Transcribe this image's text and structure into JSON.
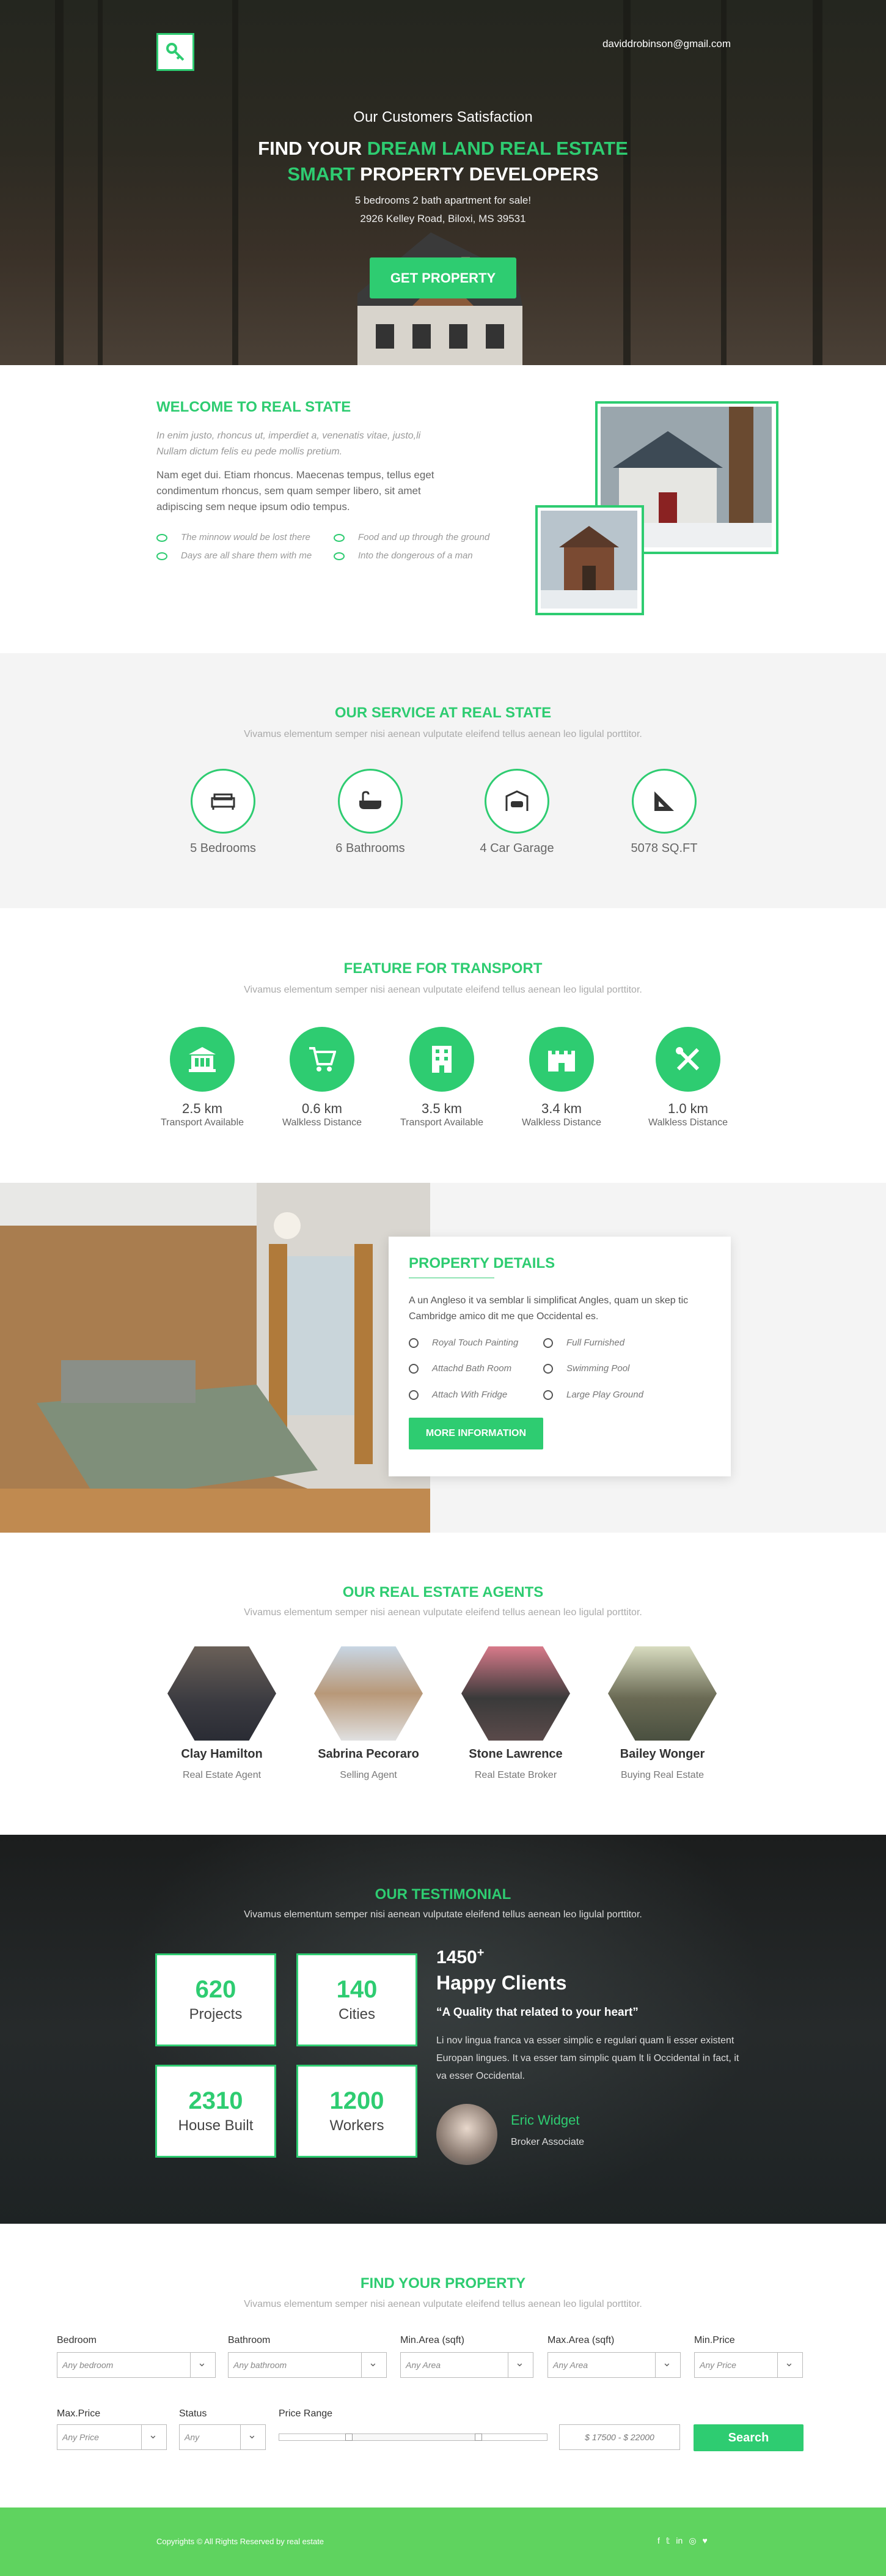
{
  "hero": {
    "email": "daviddrobinson@gmail.com",
    "subtitle": "Our Customers Satisfaction",
    "title_white_1": "FIND YOUR ",
    "title_green_1": "DREAM LAND REAL ESTATE",
    "title_green_2": "SMART ",
    "title_white_2": "PROPERTY DEVELOPERS",
    "desc_line1": "5 bedrooms 2 bath apartment for sale!",
    "desc_line2": "2926 Kelley Road, Biloxi, MS 39531",
    "button": "GET PROPERTY",
    "logo_icon": "key-icon"
  },
  "welcome": {
    "title": "WELCOME TO REAL STATE",
    "italic": "In enim justo, rhoncus ut, imperdiet a, venenatis vitae, justo,li Nullam dictum felis eu pede mollis pretium.",
    "para": "Nam eget dui. Etiam rhoncus. Maecenas tempus, tellus eget condimentum rhoncus, sem quam semper libero, sit amet adipiscing sem neque ipsum odio tempus.",
    "checks": [
      "The minnow would be lost there",
      "Food and up through the ground",
      "Days are all share them with me",
      "Into the dongerous of a man"
    ]
  },
  "service": {
    "title": "OUR SERVICE AT REAL STATE",
    "subtitle": "Vivamus elementum semper nisi aenean vulputate eleifend tellus aenean leo ligulal porttitor.",
    "items": [
      {
        "label": "5 Bedrooms",
        "icon": "bed-icon"
      },
      {
        "label": "6 Bathrooms",
        "icon": "bathtub-icon"
      },
      {
        "label": "4 Car Garage",
        "icon": "car-garage-icon"
      },
      {
        "label": "5078 SQ.FT",
        "icon": "ruler-set-square-icon"
      }
    ]
  },
  "transport": {
    "title": "FEATURE FOR TRANSPORT",
    "subtitle": "Vivamus elementum semper nisi aenean vulputate eleifend tellus aenean leo ligulal porttitor.",
    "items": [
      {
        "value": "2.5 km",
        "label": "Transport Available",
        "icon": "bank-icon"
      },
      {
        "value": "0.6 km",
        "label": "Walkless Distance",
        "icon": "shopping-cart-icon"
      },
      {
        "value": "3.5 km",
        "label": "Transport Available",
        "icon": "office-building-icon"
      },
      {
        "value": "3.4 km",
        "label": "Walkless Distance",
        "icon": "castle-icon"
      },
      {
        "value": "1.0 km",
        "label": "Walkless Distance",
        "icon": "tools-icon"
      }
    ]
  },
  "property": {
    "title": "PROPERTY DETAILS",
    "desc": "A un Angleso it va semblar li simplificat Angles, quam un skep tic Cambridge amico dit me que Occidental es.",
    "features": [
      "Royal Touch Painting",
      "Full Furnished",
      "Attachd Bath Room",
      "Swimming Pool",
      "Attach With Fridge",
      "Large Play Ground"
    ],
    "button": "MORE INFORMATION"
  },
  "agents": {
    "title": "OUR REAL ESTATE AGENTS",
    "subtitle": "Vivamus elementum semper nisi aenean vulputate eleifend tellus aenean leo ligulal porttitor.",
    "list": [
      {
        "name": "Clay Hamilton",
        "role": "Real Estate Agent"
      },
      {
        "name": "Sabrina Pecoraro",
        "role": "Selling Agent"
      },
      {
        "name": "Stone Lawrence",
        "role": "Real Estate Broker"
      },
      {
        "name": "Bailey Wonger",
        "role": "Buying Real Estate"
      }
    ]
  },
  "testimonial": {
    "title": "OUR TESTIMONIAL",
    "subtitle": "Vivamus elementum semper nisi aenean vulputate eleifend tellus aenean leo ligulal porttitor.",
    "stats": [
      {
        "n": "620",
        "l": "Projects"
      },
      {
        "n": "140",
        "l": "Cities"
      },
      {
        "n": "2310",
        "l": "House Built"
      },
      {
        "n": "1200",
        "l": "Workers"
      }
    ],
    "count": "1450",
    "count_sup": "+",
    "heading": "Happy Clients",
    "quote": "“A Quality that related to your heart”",
    "text": "Li nov lingua franca va esser  simplic e regulari quam li esser existent Europan lingues. It va esser tam simplic quam lt li Occidental in fact, it va esser Occidental.",
    "person": "Eric Widget",
    "person_role": "Broker Associate"
  },
  "find": {
    "title": "FIND YOUR PROPERTY",
    "subtitle": "Vivamus elementum semper nisi aenean vulputate eleifend tellus aenean leo ligulal porttitor.",
    "labels": {
      "bedroom": "Bedroom",
      "bathroom": "Bathroom",
      "min_area": "Min.Area (sqft)",
      "max_area": "Max.Area (sqft)",
      "min_price": "Min.Price",
      "max_price": "Max.Price",
      "status": "Status",
      "price_range": "Price Range"
    },
    "values": {
      "bedroom": "Any bedroom",
      "bathroom": "Any bathroom",
      "min_area": "Any Area",
      "max_area": "Any Area",
      "min_price": "Any Price",
      "max_price": "Any Price",
      "status": "Any",
      "range": "$ 17500 - $ 22000"
    },
    "range_low": 0.26,
    "range_high": 0.74,
    "button": "Search"
  },
  "footer": {
    "copyright": "Copyrights © All Rights Reserved by real estate",
    "social": [
      "f",
      "𝕥",
      "in",
      "◎",
      "♥"
    ]
  },
  "colors": {
    "accent": "#2ecc71",
    "footer": "#5fd35f"
  }
}
